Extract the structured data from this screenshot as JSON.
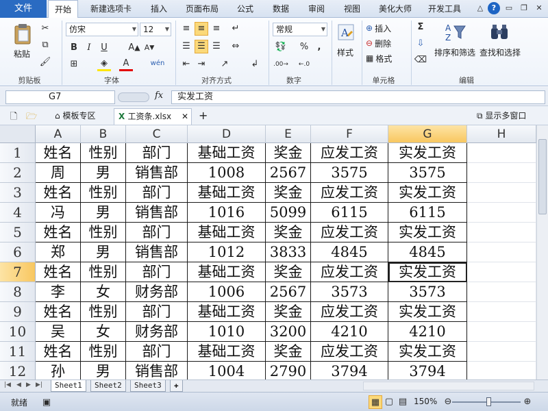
{
  "ribbon_tabs": [
    "文件",
    "开始",
    "新建选项卡",
    "插入",
    "页面布局",
    "公式",
    "数据",
    "审阅",
    "视图",
    "美化大师",
    "开发工具"
  ],
  "ribbon": {
    "paste_label": "粘贴",
    "clipboard_label": "剪贴板",
    "font_name": "仿宋",
    "font_size": "12",
    "font_label": "字体",
    "align_label": "对齐方式",
    "number_format": "常规",
    "number_label": "数字",
    "style_label": "样式",
    "insert_label": "插入",
    "delete_label": "删除",
    "format_label": "格式",
    "cells_label": "单元格",
    "sort_filter_label": "排序和筛选",
    "find_select_label": "查找和选择",
    "editing_label": "编辑",
    "percent_symbol": "%",
    "comma_symbol": ","
  },
  "formula_bar": {
    "name_box": "G7",
    "fx": "fx",
    "value": "实发工资"
  },
  "doc_tabs": {
    "template_zone": "模板专区",
    "workbook": "工资条.xlsx",
    "add": "+",
    "multi_window": "显示多窗口"
  },
  "grid": {
    "columns": [
      "A",
      "B",
      "C",
      "D",
      "E",
      "F",
      "G",
      "H"
    ],
    "rows": [
      {
        "num": "1",
        "cells": [
          "姓名",
          "性别",
          "部门",
          "基础工资",
          "奖金",
          "应发工资",
          "实发工资"
        ]
      },
      {
        "num": "2",
        "cells": [
          "周",
          "男",
          "销售部",
          "1008",
          "2567",
          "3575",
          "3575"
        ]
      },
      {
        "num": "3",
        "cells": [
          "姓名",
          "性别",
          "部门",
          "基础工资",
          "奖金",
          "应发工资",
          "实发工资"
        ]
      },
      {
        "num": "4",
        "cells": [
          "冯",
          "男",
          "销售部",
          "1016",
          "5099",
          "6115",
          "6115"
        ]
      },
      {
        "num": "5",
        "cells": [
          "姓名",
          "性别",
          "部门",
          "基础工资",
          "奖金",
          "应发工资",
          "实发工资"
        ]
      },
      {
        "num": "6",
        "cells": [
          "郑",
          "男",
          "销售部",
          "1012",
          "3833",
          "4845",
          "4845"
        ]
      },
      {
        "num": "7",
        "cells": [
          "姓名",
          "性别",
          "部门",
          "基础工资",
          "奖金",
          "应发工资",
          "实发工资"
        ]
      },
      {
        "num": "8",
        "cells": [
          "李",
          "女",
          "财务部",
          "1006",
          "2567",
          "3573",
          "3573"
        ]
      },
      {
        "num": "9",
        "cells": [
          "姓名",
          "性别",
          "部门",
          "基础工资",
          "奖金",
          "应发工资",
          "实发工资"
        ]
      },
      {
        "num": "10",
        "cells": [
          "吴",
          "女",
          "财务部",
          "1010",
          "3200",
          "4210",
          "4210"
        ]
      },
      {
        "num": "11",
        "cells": [
          "姓名",
          "性别",
          "部门",
          "基础工资",
          "奖金",
          "应发工资",
          "实发工资"
        ]
      },
      {
        "num": "12",
        "cells": [
          "孙",
          "男",
          "销售部",
          "1004",
          "2790",
          "3794",
          "3794"
        ]
      }
    ],
    "active_cell": "G7"
  },
  "sheets": [
    "Sheet1",
    "Sheet2",
    "Sheet3"
  ],
  "status": {
    "ready": "就绪",
    "zoom": "150%"
  },
  "colors": {
    "file_tab": "#2a6bc2",
    "selected_header": "#f8c760",
    "grid_line": "#1a1a1a"
  }
}
